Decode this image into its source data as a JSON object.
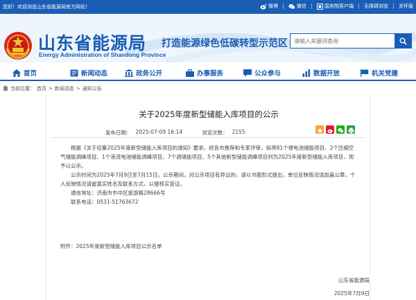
{
  "topbar": {
    "welcome": "您好！欢迎浏览山东省能源局官方网站！",
    "links": [
      "微博",
      "微信",
      "国务院客户端",
      "无障碍浏览",
      "关怀版"
    ]
  },
  "header": {
    "site_name": "山东省能源局",
    "site_name_en": "Energy Administration of Shandong Province",
    "slogan": "打造能源绿色低碳转型示范区",
    "search_placeholder": "请输入关键词查询"
  },
  "nav": {
    "items": [
      "首页",
      "新闻动态",
      "政务公开",
      "办事服务",
      "公众参与",
      "数据开放",
      "机关党建"
    ]
  },
  "breadcrumb": [
    "当前位置：",
    "首页",
    ">",
    "新闻动态",
    ">",
    "通知公告"
  ],
  "article": {
    "title": "关于2025年度新型储能入库项目的公示",
    "publish_label": "发布日期：",
    "publish_date": "2025-07-09 16:14",
    "views_label": "浏览次数：",
    "views": "2155",
    "paragraphs": [
      "根据《关于征集2025年度新型储能入库项目的通知》要求，经各市推荐和专家评审，拟将81个锂电池储能项目、2个压缩空气储能调峰项目、1个液流电池储能调峰项目、7个调储能项目、5个其他新型储能调峰项目列为2025年度新型储能入库项目，现予以公示。",
      "公示时间为2025年7月9日至7月15日。公示期间，对公示项目有异议的，请以书面形式提出，单位反映情况请加盖公章，个人反映情况请留真实姓名及联系方式，以便核实查证。"
    ],
    "address": "通信地址：济南市市中区旅游路28666号",
    "phone": "联系电话：0531-51763672",
    "attachment": "附件：2025年度新型储能入库项目公示名单",
    "signer": "山东省能源局",
    "date": "2025年7月9日"
  }
}
